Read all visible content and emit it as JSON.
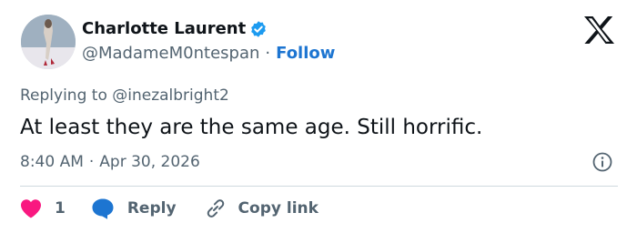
{
  "author": {
    "name": "Charlotte Laurent",
    "handle": "@MadameM0ntespan",
    "separator": "·",
    "follow_label": "Follow"
  },
  "icons": {
    "avatar": "profile-photo",
    "verified": "verified-badge-icon",
    "brand": "x-logo-icon",
    "info": "info-icon",
    "like": "heart-icon",
    "reply": "speech-bubble-icon",
    "copy": "link-icon"
  },
  "tweet": {
    "replying_to": "Replying to @inezalbright2",
    "text": "At least they are the same age. Still horrific.",
    "time": "8:40 AM",
    "separator": "·",
    "date": "Apr 30, 2026"
  },
  "actions": {
    "like_count": "1",
    "reply_label": "Reply",
    "copy_label": "Copy link"
  },
  "colors": {
    "text": "#0f1419",
    "muted": "#536471",
    "accent": "#1d75d1",
    "verified": "#1d9bf0",
    "like": "#f91880",
    "divider": "#cfd9de"
  }
}
